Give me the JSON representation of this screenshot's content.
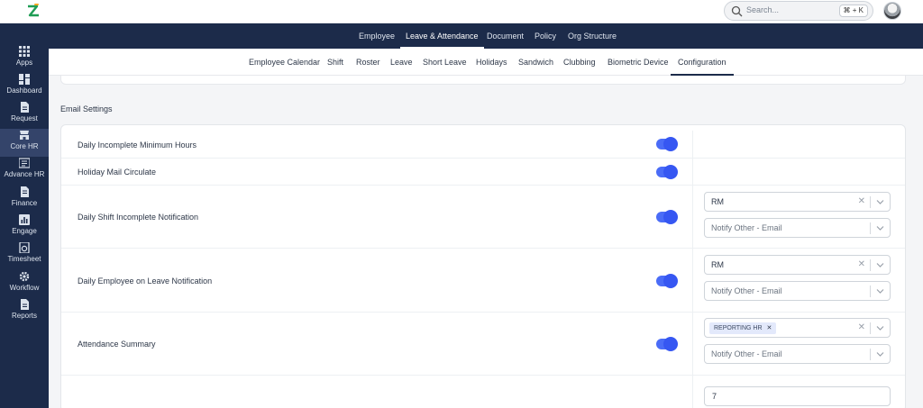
{
  "search": {
    "placeholder": "Search...",
    "shortcut": "⌘ + K"
  },
  "main_nav": [
    "Employee",
    "Leave & Attendance",
    "Document",
    "Policy",
    "Org Structure"
  ],
  "main_nav_active": "Leave & Attendance",
  "sidebar": [
    {
      "label": "Apps",
      "icon": "apps-grid-icon"
    },
    {
      "label": "Dashboard",
      "icon": "dashboard-icon"
    },
    {
      "label": "Request",
      "icon": "request-doc-icon"
    },
    {
      "label": "Core HR",
      "icon": "core-hr-icon",
      "active": true
    },
    {
      "label": "Advance HR",
      "icon": "advance-hr-icon"
    },
    {
      "label": "Finance",
      "icon": "finance-doc-icon"
    },
    {
      "label": "Engage",
      "icon": "engage-chart-icon"
    },
    {
      "label": "Timesheet",
      "icon": "timesheet-icon"
    },
    {
      "label": "Workflow",
      "icon": "workflow-gear-icon"
    },
    {
      "label": "Reports",
      "icon": "reports-doc-icon"
    }
  ],
  "sub_nav": [
    "Employee Calendar",
    "Shift",
    "Roster",
    "Leave",
    "Short Leave",
    "Holidays",
    "Sandwich",
    "Clubbing",
    "Biometric Device",
    "Configuration"
  ],
  "sub_nav_active": "Configuration",
  "section_title": "Email Settings",
  "rows": [
    {
      "label": "Daily Incomplete Minimum Hours",
      "enabled": true
    },
    {
      "label": "Holiday Mail Circulate",
      "enabled": true
    },
    {
      "label": "Daily Shift Incomplete Notification",
      "enabled": true,
      "select1_value": "RM",
      "select2_placeholder": "Notify Other - Email"
    },
    {
      "label": "Daily Employee on Leave Notification",
      "enabled": true,
      "select1_value": "RM",
      "select2_placeholder": "Notify Other - Email"
    },
    {
      "label": "Attendance Summary",
      "enabled": true,
      "chip": "REPORTING HR",
      "select2_placeholder": "Notify Other - Email"
    }
  ],
  "last_row_value": "7",
  "colors": {
    "nav_bg": "#1c2b4a",
    "toggle_on": "#3657f2",
    "chip_bg": "#e3e9fb"
  }
}
